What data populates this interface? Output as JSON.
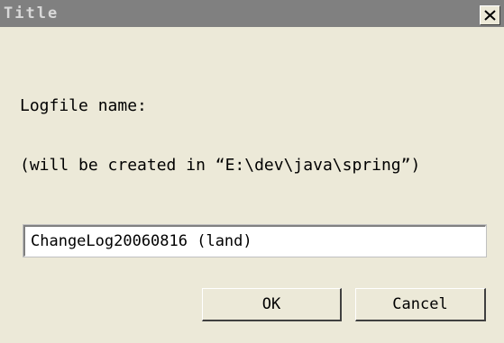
{
  "window": {
    "title": "Title",
    "close_icon": "close-icon"
  },
  "prompt": {
    "line1": "Logfile name:",
    "line2": "(will be created in “E:\\dev\\java\\spring”)"
  },
  "input": {
    "value": "ChangeLog20060816 (land)"
  },
  "buttons": {
    "ok_label": "OK",
    "cancel_label": "Cancel"
  },
  "colors": {
    "titlebar": "#808080",
    "title_text": "#d8d8d8",
    "dialog_bg": "#ece9d8"
  }
}
